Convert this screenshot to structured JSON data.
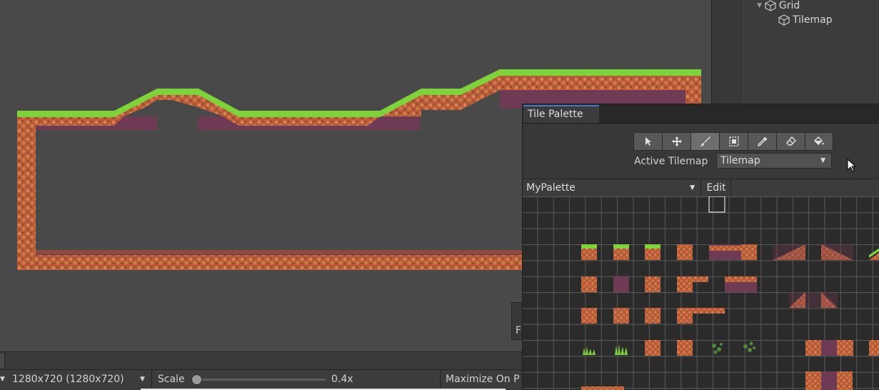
{
  "hierarchy": {
    "items": [
      {
        "label": "Grid",
        "icon": "gameobject-icon",
        "expanded": true
      },
      {
        "label": "Tilemap",
        "icon": "gameobject-icon"
      }
    ]
  },
  "game_toolbar": {
    "resolution": "1280x720 (1280x720)",
    "scale_label": "Scale",
    "scale_value": "0.4x",
    "scale_fraction": 0.0,
    "maximize_label": "Maximize On P",
    "side_letter": "F"
  },
  "tile_palette": {
    "tab_label": "Tile Palette",
    "tools": [
      {
        "name": "select-tool-button",
        "icon": "arrow-cursor-icon"
      },
      {
        "name": "move-tool-button",
        "icon": "move-arrows-icon"
      },
      {
        "name": "paint-brush-tool-button",
        "icon": "brush-icon",
        "active": true
      },
      {
        "name": "box-fill-tool-button",
        "icon": "box-fill-icon"
      },
      {
        "name": "picker-tool-button",
        "icon": "eyedropper-icon"
      },
      {
        "name": "erase-tool-button",
        "icon": "eraser-icon"
      },
      {
        "name": "flood-fill-tool-button",
        "icon": "bucket-icon"
      }
    ],
    "active_tilemap_label": "Active Tilemap",
    "active_tilemap_value": "Tilemap",
    "palette_name": "MyPalette",
    "edit_label": "Edit"
  },
  "colors": {
    "grass": "#7fd33a",
    "dirt": "#c6683e",
    "dirt_dark": "#8a4a40",
    "background_shadow": "#6e3a52",
    "accent": "#3d7dc9"
  }
}
